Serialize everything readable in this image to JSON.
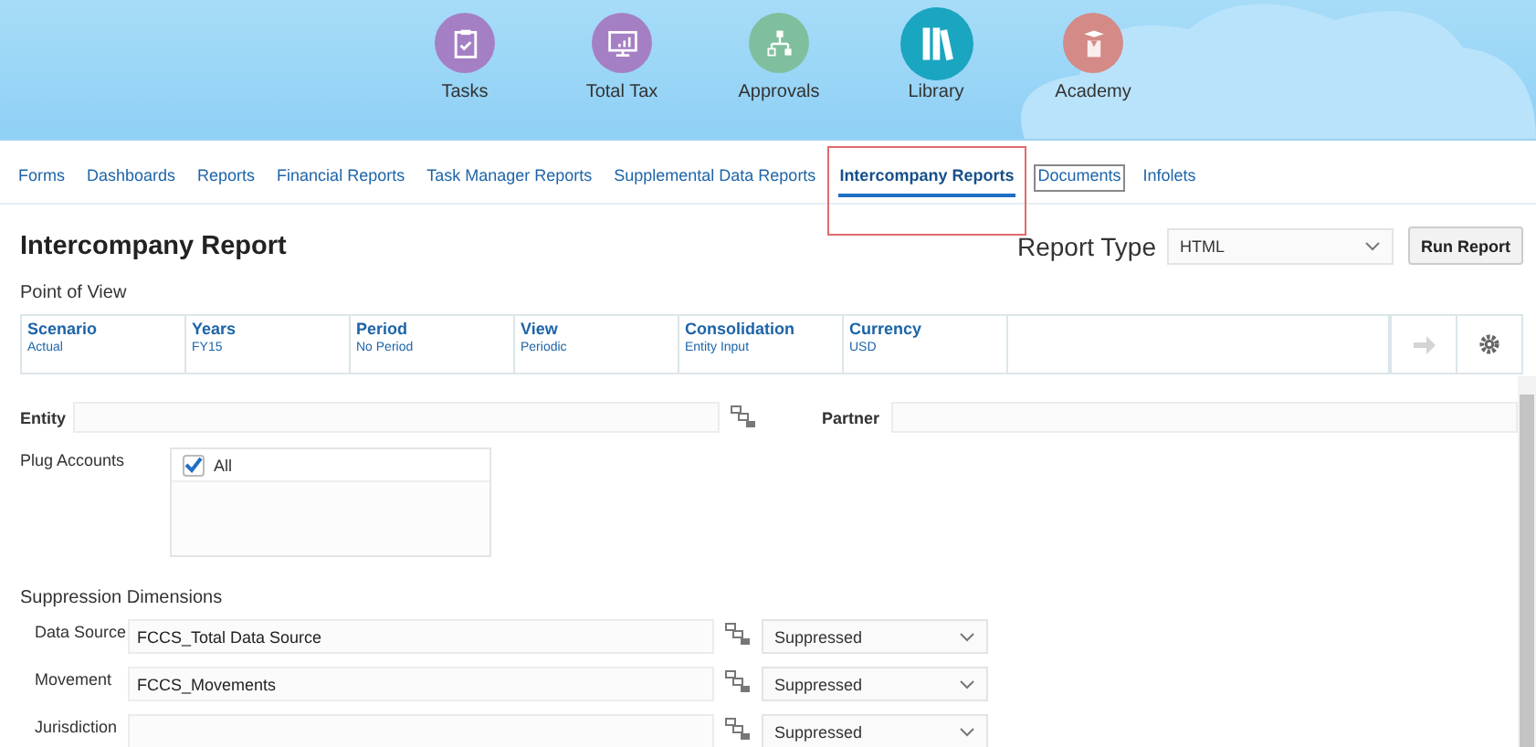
{
  "nav": [
    {
      "label": "Tasks",
      "color": "#a57fc4",
      "selected": false
    },
    {
      "label": "Total Tax",
      "color": "#a57fc4",
      "selected": false
    },
    {
      "label": "Approvals",
      "color": "#7fbf9e",
      "selected": false
    },
    {
      "label": "Library",
      "color": "#1aa5c0",
      "selected": true
    },
    {
      "label": "Academy",
      "color": "#d48a86",
      "selected": false
    }
  ],
  "tabs": [
    {
      "label": "Forms",
      "selected": false,
      "focused": false,
      "highlighted": false
    },
    {
      "label": "Dashboards",
      "selected": false,
      "focused": false,
      "highlighted": false
    },
    {
      "label": "Reports",
      "selected": false,
      "focused": false,
      "highlighted": false
    },
    {
      "label": "Financial Reports",
      "selected": false,
      "focused": false,
      "highlighted": false
    },
    {
      "label": "Task Manager Reports",
      "selected": false,
      "focused": false,
      "highlighted": false
    },
    {
      "label": "Supplemental Data Reports",
      "selected": false,
      "focused": false,
      "highlighted": false
    },
    {
      "label": "Intercompany Reports",
      "selected": true,
      "focused": false,
      "highlighted": true
    },
    {
      "label": "Documents",
      "selected": false,
      "focused": true,
      "highlighted": false
    },
    {
      "label": "Infolets",
      "selected": false,
      "focused": false,
      "highlighted": false
    }
  ],
  "page_title": "Intercompany Report",
  "report_type": {
    "label": "Report Type",
    "value": "HTML"
  },
  "run_button": "Run Report",
  "pov": {
    "heading": "Point of View",
    "items": [
      {
        "label": "Scenario",
        "value": "Actual"
      },
      {
        "label": "Years",
        "value": "FY15"
      },
      {
        "label": "Period",
        "value": "No Period"
      },
      {
        "label": "View",
        "value": "Periodic"
      },
      {
        "label": "Consolidation",
        "value": "Entity Input"
      },
      {
        "label": "Currency",
        "value": "USD"
      }
    ]
  },
  "entity": {
    "label": "Entity"
  },
  "partner": {
    "label": "Partner"
  },
  "plug_accounts": {
    "label": "Plug Accounts",
    "options": [
      {
        "label": "All",
        "checked": true
      }
    ]
  },
  "suppression": {
    "heading": "Suppression Dimensions",
    "rows": [
      {
        "label": "Data Source",
        "value": "FCCS_Total Data Source",
        "status": "Suppressed"
      },
      {
        "label": "Movement",
        "value": "FCCS_Movements",
        "status": "Suppressed"
      },
      {
        "label": "Jurisdiction",
        "status": "Suppressed"
      }
    ]
  }
}
